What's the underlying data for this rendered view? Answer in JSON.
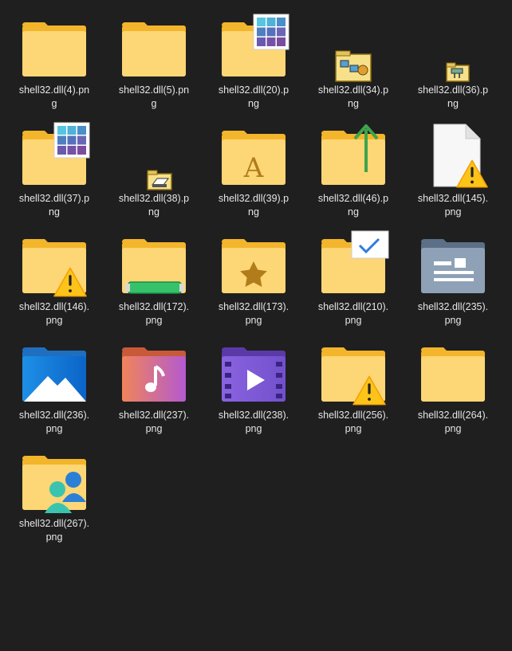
{
  "files": [
    {
      "name": "shell32.dll(4).png",
      "line1": "shell32.dll(4).pn",
      "line2": "g",
      "icon": "folder-icon"
    },
    {
      "name": "shell32.dll(5).png",
      "line1": "shell32.dll(5).pn",
      "line2": "g",
      "icon": "folder-icon"
    },
    {
      "name": "shell32.dll(20).png",
      "line1": "shell32.dll(20).p",
      "line2": "ng",
      "icon": "folder-grid-icon"
    },
    {
      "name": "shell32.dll(34).png",
      "line1": "shell32.dll(34).p",
      "line2": "ng",
      "icon": "network-folder-small-icon"
    },
    {
      "name": "shell32.dll(36).png",
      "line1": "shell32.dll(36).p",
      "line2": "ng",
      "icon": "shared-folder-small-icon"
    },
    {
      "name": "shell32.dll(37).png",
      "line1": "shell32.dll(37).p",
      "line2": "ng",
      "icon": "folder-grid-icon"
    },
    {
      "name": "shell32.dll(38).png",
      "line1": "shell32.dll(38).p",
      "line2": "ng",
      "icon": "printer-folder-small-icon"
    },
    {
      "name": "shell32.dll(39).png",
      "line1": "shell32.dll(39).p",
      "line2": "ng",
      "icon": "fonts-folder-icon"
    },
    {
      "name": "shell32.dll(46).png",
      "line1": "shell32.dll(46).p",
      "line2": "ng",
      "icon": "folder-up-arrow-icon"
    },
    {
      "name": "shell32.dll(145).png",
      "line1": "shell32.dll(145).",
      "line2": "png",
      "icon": "file-warning-icon"
    },
    {
      "name": "shell32.dll(146).png",
      "line1": "shell32.dll(146).",
      "line2": "png",
      "icon": "folder-warning-icon"
    },
    {
      "name": "shell32.dll(172).png",
      "line1": "shell32.dll(172).",
      "line2": "png",
      "icon": "folder-progress-icon"
    },
    {
      "name": "shell32.dll(173).png",
      "line1": "shell32.dll(173).",
      "line2": "png",
      "icon": "favorites-folder-icon"
    },
    {
      "name": "shell32.dll(210).png",
      "line1": "shell32.dll(210).",
      "line2": "png",
      "icon": "folder-checkbox-icon"
    },
    {
      "name": "shell32.dll(235).png",
      "line1": "shell32.dll(235).",
      "line2": "png",
      "icon": "contacts-folder-icon"
    },
    {
      "name": "shell32.dll(236).png",
      "line1": "shell32.dll(236).",
      "line2": "png",
      "icon": "pictures-folder-icon"
    },
    {
      "name": "shell32.dll(237).png",
      "line1": "shell32.dll(237).",
      "line2": "png",
      "icon": "music-folder-icon"
    },
    {
      "name": "shell32.dll(238).png",
      "line1": "shell32.dll(238).",
      "line2": "png",
      "icon": "videos-folder-icon"
    },
    {
      "name": "shell32.dll(256).png",
      "line1": "shell32.dll(256).",
      "line2": "png",
      "icon": "folder-warning-icon"
    },
    {
      "name": "shell32.dll(264).png",
      "line1": "shell32.dll(264).",
      "line2": "png",
      "icon": "folder-icon"
    },
    {
      "name": "shell32.dll(267).png",
      "line1": "shell32.dll(267).",
      "line2": "png",
      "icon": "users-folder-icon"
    }
  ],
  "colors": {
    "background": "#1f1f1f",
    "folder_front": "#fdd675",
    "folder_back": "#f3b52b",
    "text": "#e6e6e6"
  }
}
